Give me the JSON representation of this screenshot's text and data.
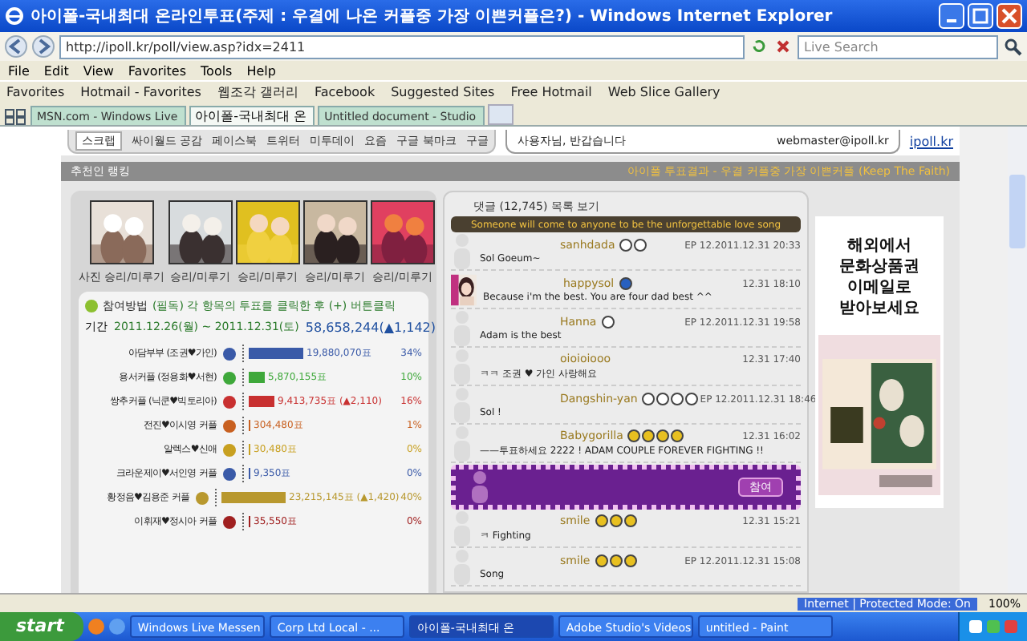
{
  "window": {
    "title": "아이폴-국내최대 온라인투표(주제 : 우결에 나온 커플중 가장 이쁜커플은?) - Windows Internet Explorer"
  },
  "address": {
    "value": "http://ipoll.kr/poll/view.asp?idx=2411",
    "search_placeholder": "Live Search"
  },
  "menu": [
    "File",
    "Edit",
    "View",
    "Favorites",
    "Tools",
    "Help"
  ],
  "favorites": [
    {
      "label": "Favorites"
    },
    {
      "label": "Hotmail - Favorites"
    },
    {
      "label": "웹조각 갤러리"
    },
    {
      "label": "Facebook"
    },
    {
      "label": "Suggested Sites"
    },
    {
      "label": "Free Hotmail"
    },
    {
      "label": "Web Slice Gallery"
    }
  ],
  "tabs": [
    {
      "label": "MSN.com - Windows Live",
      "selected": false
    },
    {
      "label": "아이폴-국내최대 온",
      "selected": true
    },
    {
      "label": "Untitled document - Studio",
      "selected": false
    }
  ],
  "share": [
    "스크랩",
    "싸이월드 공감",
    "페이스북",
    "트위터",
    "미투데이",
    "요즘",
    "구글 북마크",
    "구글"
  ],
  "login": {
    "user": "사용자님, 반갑습니다",
    "email": "webmaster@ipoll.kr",
    "link": "ipoll.kr"
  },
  "header": {
    "left": "추천인 랭킹",
    "right": "아이폴 투표결과 - 우결 커플중 가장 이쁜커플 (Keep The Faith)"
  },
  "photos": [
    {
      "caption": "사진 승리/미루기"
    },
    {
      "caption": "승리/미루기"
    },
    {
      "caption": "승리/미루기"
    },
    {
      "caption": "승리/미루기"
    },
    {
      "caption": "승리/미루기"
    }
  ],
  "poll": {
    "title": "참여방법",
    "notice": "(필독) 각 항목의 투표를 클릭한 후 (+) 버튼클릭",
    "period_label": "기간",
    "period": "2011.12.26(월) ~ 2011.12.31(토)",
    "total": "58,658,244(▲1,142)",
    "rows": [
      {
        "label": "아담부부 (조권♥가인)",
        "color": "#3a5aa8",
        "level": 0.34,
        "value": "19,880,070표",
        "pct": "34%"
      },
      {
        "label": "용서커플 (정용화♥서현)",
        "color": "#3ea83a",
        "level": 0.1,
        "value": "5,870,155표",
        "pct": "10%"
      },
      {
        "label": "쌍추커플 (닉쿤♥빅토리아)",
        "color": "#c83030",
        "level": 0.16,
        "value": "9,413,735표 (▲2,110)",
        "pct": "16%"
      },
      {
        "label": "전진♥이시영 커플",
        "color": "#c86020",
        "level": 0.01,
        "value": "304,480표",
        "pct": "1%"
      },
      {
        "label": "알렉스♥신애",
        "color": "#c8a020",
        "level": 0.002,
        "value": "30,480표",
        "pct": "0%"
      },
      {
        "label": "크라운제이♥서인영 커플",
        "color": "#3a5aa8",
        "level": 0.001,
        "value": "9,350표",
        "pct": "0%"
      },
      {
        "label": "황정음♥김용준 커플",
        "color": "#b8982e",
        "level": 0.4,
        "value": "23,215,145표 (▲1,420)",
        "pct": "40%"
      },
      {
        "label": "이휘재♥정시아 커플",
        "color": "#a02020",
        "level": 0.002,
        "value": "35,550표",
        "pct": "0%"
      }
    ]
  },
  "comments": {
    "title": "댓글 (12,745) 목록 보기",
    "marquee": "Someone will come to anyone to be the unforgettable love song",
    "items": [
      {
        "kind": "silhouette",
        "name": "sanhdada",
        "icons": [
          {
            "kind": "white"
          },
          {
            "kind": "white"
          }
        ],
        "text": "Sol  Goeum~",
        "date": "EP 12.2011.12.31 20:33"
      },
      {
        "name": "happysol",
        "icons": [
          {
            "kind": "blue"
          }
        ],
        "text": "Because i'm the best. You are four dad best ^^",
        "date": "12.31 18:10"
      },
      {
        "kind": "silhouette",
        "name": "Hanna",
        "icons": [
          {
            "kind": "white"
          }
        ],
        "text": "Adam is the best",
        "date": "EP 12.2011.12.31 19:58"
      },
      {
        "kind": "silhouette",
        "name": "oioioiooo",
        "text": "ㅋㅋ 조권 ♥ 가인 사랑해요",
        "date": "12.31 17:40"
      },
      {
        "kind": "silhouette",
        "name": "Dangshin-yan",
        "icons": [
          {
            "kind": "white"
          },
          {
            "kind": "white"
          },
          {
            "kind": "white"
          },
          {
            "kind": "white"
          }
        ],
        "text": "Sol !",
        "date": "EP 12.2011.12.31 18:46"
      },
      {
        "kind": "silhouette",
        "name": "Babygorilla",
        "icons": [
          {
            "kind": "yellow"
          },
          {
            "kind": "yellow"
          },
          {
            "kind": "yellow"
          },
          {
            "kind": "yellow"
          }
        ],
        "text": "——투표하세요 2222 ! ADAM COUPLE FOREVER FIGHTING !!",
        "date": "12.31 16:02"
      },
      {
        "kind": "banner",
        "button": "참여"
      },
      {
        "kind": "silhouette",
        "name": "smile",
        "icons": [
          {
            "kind": "yellow"
          },
          {
            "kind": "yellow"
          },
          {
            "kind": "yellow"
          }
        ],
        "text": "ㅋ Fighting",
        "date": "12.31 15:21"
      },
      {
        "kind": "silhouette",
        "name": "smile",
        "icons": [
          {
            "kind": "yellow"
          },
          {
            "kind": "yellow"
          },
          {
            "kind": "yellow"
          }
        ],
        "text": "Song",
        "date": "EP 12.2011.12.31 15:08"
      }
    ]
  },
  "ad": {
    "lines": [
      "해외에서",
      "문화상품권",
      "이메일로",
      "받아보세요"
    ]
  },
  "status": {
    "zone": "Internet | Protected Mode: On",
    "zoom": "100%"
  },
  "taskbar": {
    "start": "start",
    "items": [
      {
        "label": "Windows Live Messen",
        "selected": false
      },
      {
        "label": "Corp Ltd Local - ...",
        "selected": false
      },
      {
        "label": "아이폴-국내최대 온",
        "selected": true
      },
      {
        "label": "Adobe Studio's Videos",
        "selected": false
      },
      {
        "label": "untitled - Paint",
        "selected": false
      }
    ]
  }
}
